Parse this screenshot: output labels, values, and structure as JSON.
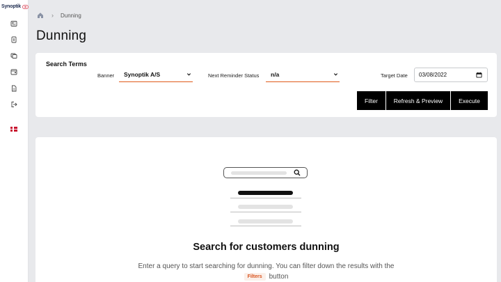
{
  "app": {
    "logo_text": "Synoptik"
  },
  "breadcrumb": {
    "current": "Dunning"
  },
  "page": {
    "title": "Dunning"
  },
  "search": {
    "title": "Search Terms",
    "banner_label": "Banner",
    "banner_value": "Synoptik A/S",
    "reminder_label": "Next Reminder Status",
    "reminder_value": "n/a",
    "date_label": "Target Date",
    "date_value": "03/08/2022",
    "filter_label": "Filter",
    "refresh_label": "Refresh & Preview",
    "execute_label": "Execute"
  },
  "empty_state": {
    "title": "Search for customers dunning",
    "text": "Enter a query to start searching for dunning. You can filter down the results with the",
    "chip": "Filters",
    "text_end": "button"
  },
  "colors": {
    "accent": "#e05a1a",
    "button_bg": "#000000",
    "page_bg": "#e8e9ec"
  }
}
